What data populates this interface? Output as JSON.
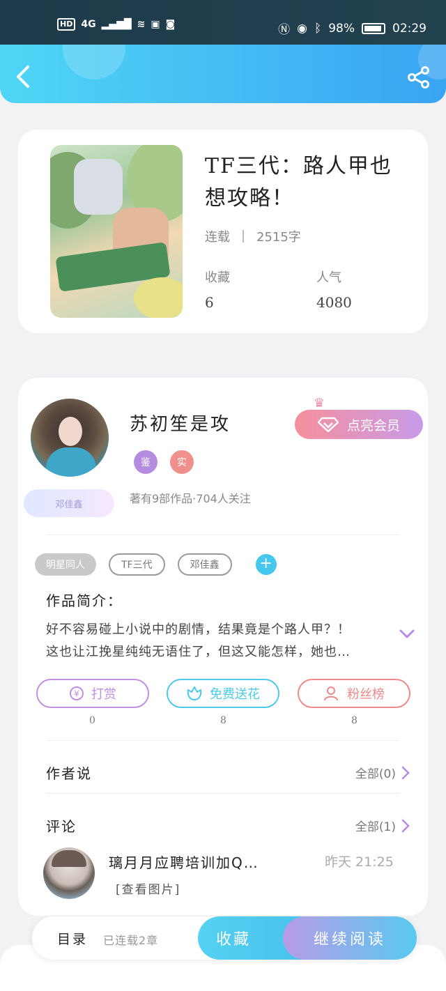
{
  "status_bar": {
    "network_hd": "HD",
    "network_type": "4G",
    "battery": "98%",
    "time": "02:29"
  },
  "header": {
    "back_icon": "chevron-left-icon",
    "share_icon": "share-icon"
  },
  "book": {
    "title": "TF三代：路人甲也想攻略！",
    "status": "连载",
    "word_count": "2515字",
    "favorites_label": "收藏",
    "favorites_value": "6",
    "popularity_label": "人气",
    "popularity_value": "4080"
  },
  "author": {
    "name": "苏初笙是攻",
    "badges": [
      "鉴",
      "实"
    ],
    "stats": "著有9部作品·704人关注",
    "fan_tag": "邓佳鑫",
    "vip_button": "点亮会员"
  },
  "tags": [
    "明星同人",
    "TF三代",
    "邓佳鑫"
  ],
  "intro": {
    "label": "作品简介：",
    "line1": "好不容易碰上小说中的剧情，结果竟是个路人甲？！",
    "line2": "这也让江挽星纯纯无语住了，但这又能怎样，她也…"
  },
  "actions": [
    {
      "label": "打赏",
      "count": "0"
    },
    {
      "label": "免费送花",
      "count": "8"
    },
    {
      "label": "粉丝榜",
      "count": "8"
    }
  ],
  "author_says": {
    "title": "作者说",
    "link": "全部(0)"
  },
  "comments": {
    "title": "评论",
    "link": "全部(1)",
    "first": {
      "name": "璃月月应聘培训加Q…",
      "time": "昨天 21:25",
      "text": "[查看图片]"
    }
  },
  "bottom_bar": {
    "toc": "目录",
    "toc_status": "已连载2章",
    "collect": "收藏",
    "continue": "继续阅读"
  },
  "colors": {
    "header_gradient_start": "#4fd6f5",
    "header_gradient_end": "#3aa4f3",
    "accent_blue": "#45c7ee",
    "reward_purple": "#c28fe0",
    "flower_cyan": "#4cc9ea",
    "fan_red": "#ee8a8a"
  }
}
